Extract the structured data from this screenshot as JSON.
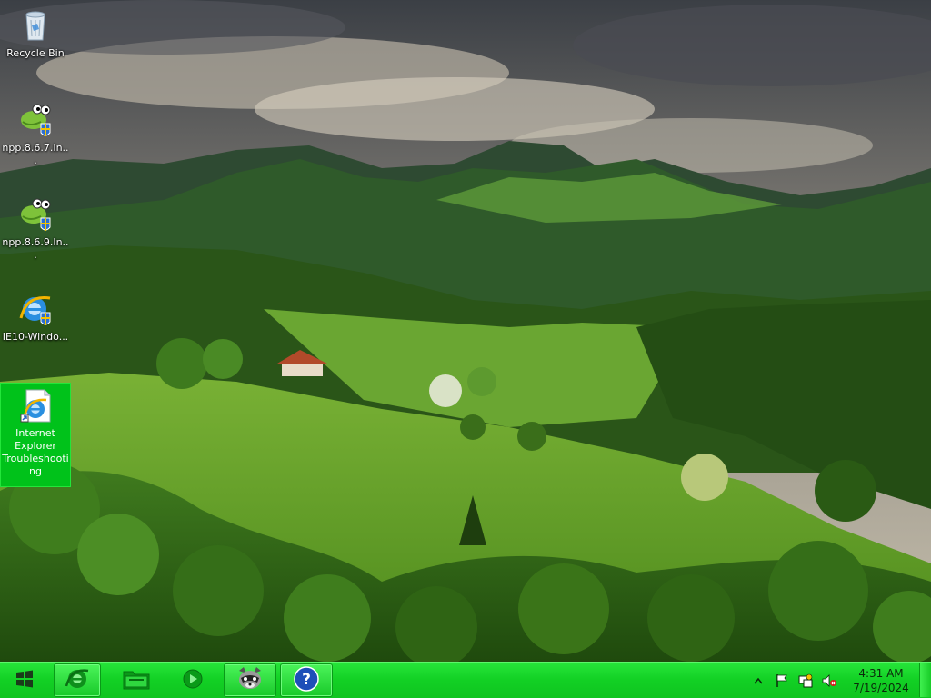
{
  "desktop": {
    "icons": [
      {
        "label": "Recycle Bin",
        "icon": "recycle-bin-icon"
      },
      {
        "label": "npp.8.6.7.In...",
        "icon": "notepad-plus-plus-icon"
      },
      {
        "label": "npp.8.6.9.In...",
        "icon": "notepad-plus-plus-icon"
      },
      {
        "label": "IE10-Windo...",
        "icon": "internet-explorer-icon"
      },
      {
        "label": "Internet Explorer Troubleshooting",
        "icon": "ie-troubleshooting-icon",
        "selected": true
      }
    ]
  },
  "taskbar": {
    "start_icon": "windows-logo-icon",
    "pinned": [
      {
        "name": "Internet Explorer",
        "icon": "internet-explorer-icon"
      },
      {
        "name": "Windows Explorer",
        "icon": "folder-icon"
      },
      {
        "name": "Windows Media Player",
        "icon": "media-player-icon"
      },
      {
        "name": "Raccoon app",
        "icon": "raccoon-icon"
      },
      {
        "name": "Help and Support",
        "icon": "help-icon"
      }
    ],
    "tray": {
      "icons": [
        "show-hidden-icons-chevron-icon",
        "action-center-flag-icon",
        "network-icon",
        "volume-muted-icon"
      ],
      "time": "4:31 AM",
      "date": "7/19/2024"
    }
  },
  "colors": {
    "taskbar": "#12d024",
    "selection": "#00c21a",
    "icon_label": "#ffffff"
  }
}
